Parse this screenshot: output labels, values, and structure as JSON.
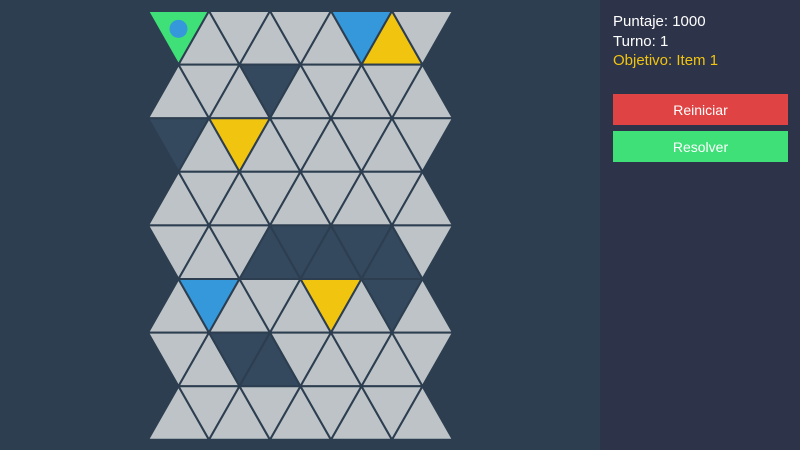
{
  "hud": {
    "score_label": "Puntaje: 1000",
    "turn_label": "Turno: 1",
    "objective_label": "Objetivo: Item 1",
    "objective_color": "#f1c40f"
  },
  "buttons": {
    "restart_label": "Reiniciar",
    "restart_color": "#e04343",
    "solve_label": "Resolver",
    "solve_color": "#3ee077"
  },
  "board": {
    "rows": 8,
    "columns": 9,
    "colors": {
      "empty": "#bdc3c7",
      "wall": "#34495e",
      "yellow": "#f1c40f",
      "blue": "#3498db",
      "player_cell": "#3ee077",
      "player_token": "#3498db",
      "grid_line": "#2c3e50"
    },
    "cells": [
      [
        "P",
        "E",
        "E",
        "E",
        "E",
        "E",
        "B",
        "Y",
        "E"
      ],
      [
        "E",
        "E",
        "E",
        "W",
        "E",
        "E",
        "E",
        "E",
        "E"
      ],
      [
        "W",
        "E",
        "Y",
        "E",
        "E",
        "E",
        "E",
        "E",
        "E"
      ],
      [
        "E",
        "E",
        "E",
        "E",
        "E",
        "E",
        "E",
        "E",
        "E"
      ],
      [
        "E",
        "E",
        "E",
        "W",
        "W",
        "W",
        "W",
        "W",
        "E"
      ],
      [
        "E",
        "B",
        "E",
        "E",
        "E",
        "Y",
        "E",
        "W",
        "E"
      ],
      [
        "E",
        "E",
        "W",
        "W",
        "E",
        "E",
        "E",
        "E",
        "E"
      ],
      [
        "E",
        "E",
        "E",
        "E",
        "E",
        "E",
        "E",
        "E",
        "E"
      ]
    ]
  }
}
